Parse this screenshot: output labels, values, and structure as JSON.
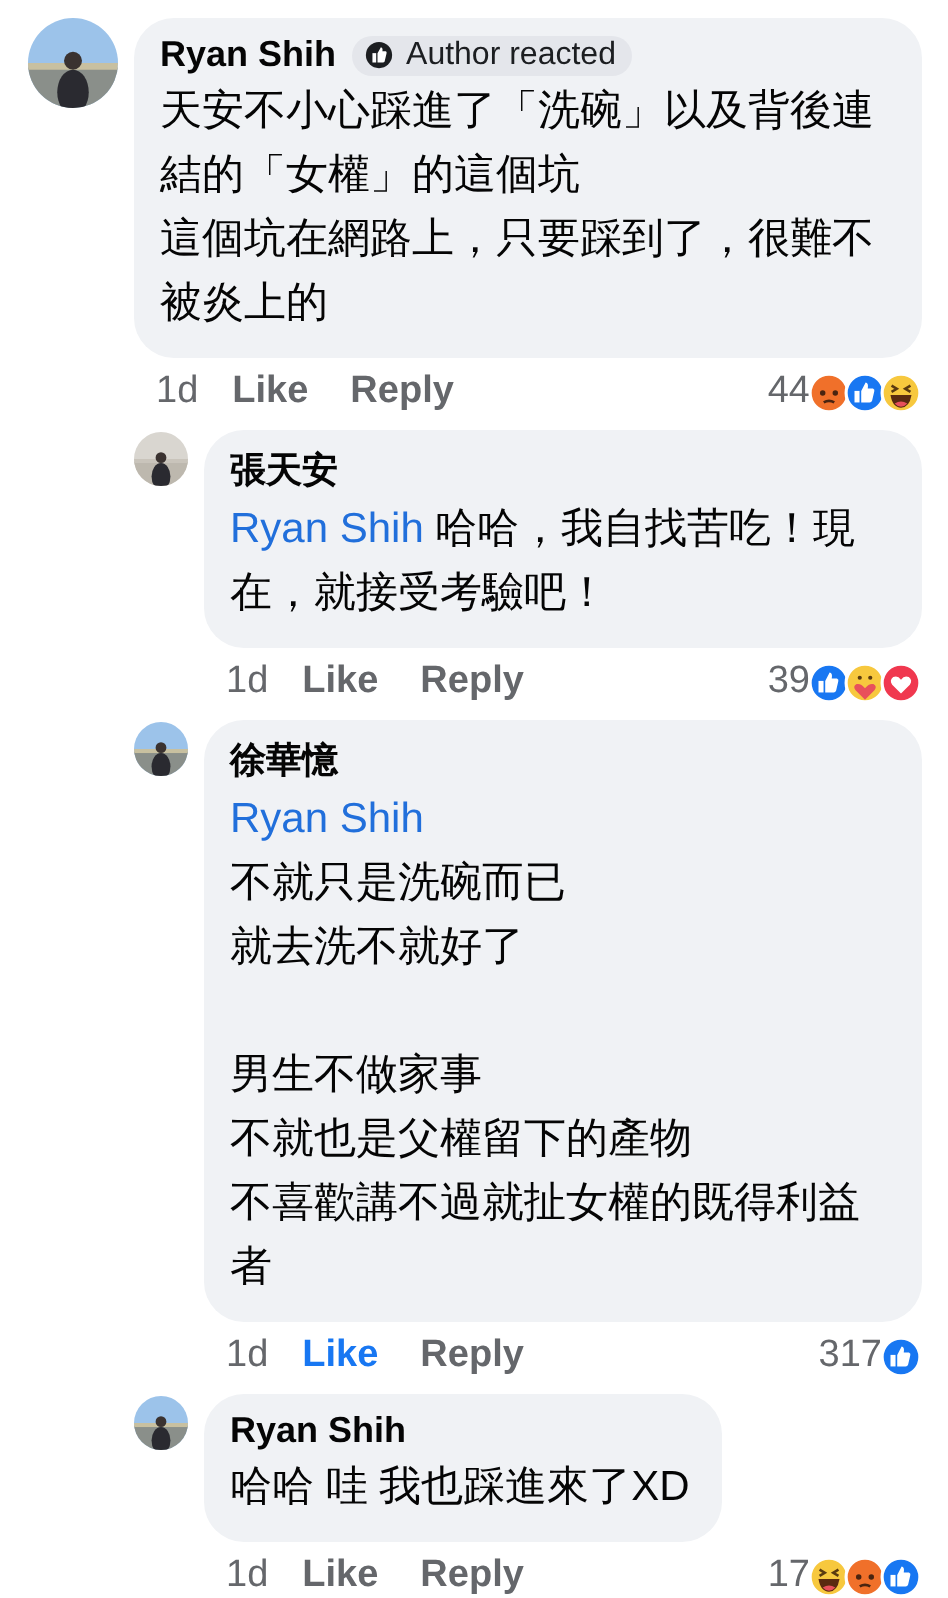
{
  "comments": [
    {
      "kind": "comment",
      "author": "Ryan Shih",
      "badge": "Author reacted",
      "paragraphs": [
        [
          {
            "text": "天安不小心踩進了「洗碗」以及背後連結的「女權」的這個坑"
          },
          {
            "text": "這個坑在網路上，只要踩到了，很難不被炎上的"
          }
        ]
      ],
      "time": "1d",
      "like": "Like",
      "liked": false,
      "reply": "Reply",
      "count": "44",
      "reactions": [
        {
          "kind": "angry"
        },
        {
          "kind": "like"
        },
        {
          "kind": "haha"
        }
      ]
    },
    {
      "kind": "reply",
      "author": "張天安",
      "paragraphs": [
        [
          {
            "mention": "Ryan Shih",
            "text": "哈哈，我自找苦吃！現在，就接受考驗吧！"
          }
        ]
      ],
      "time": "1d",
      "like": "Like",
      "liked": false,
      "reply": "Reply",
      "count": "39",
      "reactions": [
        {
          "kind": "like"
        },
        {
          "kind": "care"
        },
        {
          "kind": "love"
        }
      ]
    },
    {
      "kind": "reply",
      "author": "徐華憶",
      "paragraphs": [
        [
          {
            "mention": "Ryan Shih"
          },
          {
            "text": "不就只是洗碗而已"
          },
          {
            "text": "就去洗不就好了"
          }
        ],
        [
          {
            "text": "男生不做家事"
          },
          {
            "text": "不就也是父權留下的產物"
          },
          {
            "text": "不喜歡講不過就扯女權的既得利益者"
          }
        ]
      ],
      "time": "1d",
      "like": "Like",
      "liked": true,
      "reply": "Reply",
      "count": "317",
      "reactions": [
        {
          "kind": "like"
        }
      ]
    },
    {
      "kind": "reply",
      "author": "Ryan Shih",
      "paragraphs": [
        [
          {
            "text": "哈哈 哇 我也踩進來了XD"
          }
        ]
      ],
      "time": "1d",
      "like": "Like",
      "liked": false,
      "reply": "Reply",
      "count": "17",
      "reactions": [
        {
          "kind": "haha"
        },
        {
          "kind": "angry"
        },
        {
          "kind": "like"
        }
      ]
    }
  ]
}
